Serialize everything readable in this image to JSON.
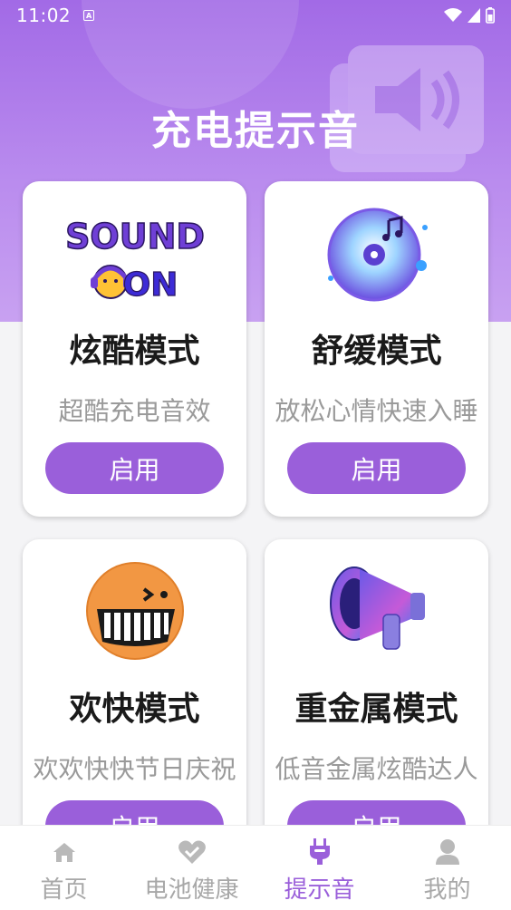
{
  "status_bar": {
    "time": "11:02",
    "notif_icon": "a-icon"
  },
  "header": {
    "title": "充电提示音"
  },
  "cards": [
    {
      "icon": "sound-on-icon",
      "logo_text_1": "SOUND",
      "logo_text_2": "ON",
      "title": "炫酷模式",
      "subtitle": "超酷充电音效",
      "button": "启用"
    },
    {
      "icon": "music-disc-icon",
      "title": "舒缓模式",
      "subtitle": "放松心情快速入睡",
      "button": "启用"
    },
    {
      "icon": "happy-face-icon",
      "title": "欢快模式",
      "subtitle": "欢欢快快节日庆祝",
      "button": "启用"
    },
    {
      "icon": "megaphone-icon",
      "title": "重金属模式",
      "subtitle": "低音金属炫酷达人",
      "button": "启用"
    }
  ],
  "nav": {
    "items": [
      {
        "label": "首页",
        "icon": "home-icon",
        "active": false
      },
      {
        "label": "电池健康",
        "icon": "heart-check-icon",
        "active": false
      },
      {
        "label": "提示音",
        "icon": "plug-icon",
        "active": true
      },
      {
        "label": "我的",
        "icon": "user-icon",
        "active": false
      }
    ]
  },
  "colors": {
    "accent": "#9a5fda",
    "header_bg": "#a26ae6"
  }
}
